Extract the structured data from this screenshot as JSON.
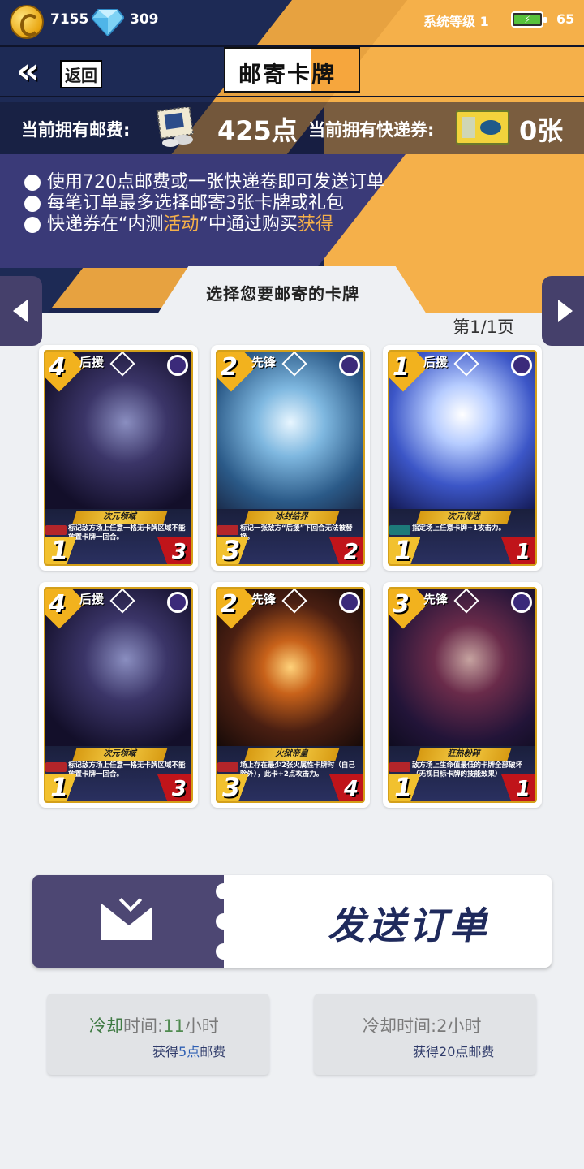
{
  "status": {
    "coins": "7155",
    "gems": "309",
    "system_level": "系统等级 1",
    "battery": "65"
  },
  "header": {
    "back_label": "返回",
    "title": "邮寄卡牌"
  },
  "currency": {
    "postage_label": "当前拥有邮费:",
    "postage_value": "425点",
    "ticket_label": "当前拥有快递券:",
    "ticket_value": "0张"
  },
  "rules": [
    {
      "text": "使用720点邮费或一张快递卷即可发送订单"
    },
    {
      "text": "每笔订单最多选择邮寄3张卡牌或礼包"
    },
    {
      "text_a": "快递券在“内测",
      "text_b": "活动",
      "text_c": "”中通过购买",
      "text_d": "获得"
    }
  ],
  "select_title": "选择您要邮寄的卡牌",
  "page_info": "第1/1页",
  "cards": [
    {
      "cost": "4",
      "role": "后援",
      "name": "次元领域",
      "desc": "标记敌方场上任意一格无卡牌区域不能放置卡牌一回合。",
      "atk": "1",
      "hp": "3",
      "art": "void"
    },
    {
      "cost": "2",
      "role": "先锋",
      "name": "冰封结界",
      "desc": "标记一张敌方“后援”下回合无法被替换。",
      "atk": "3",
      "hp": "2",
      "art": "ice"
    },
    {
      "cost": "1",
      "role": "后援",
      "name": "次元传送",
      "desc": "指定场上任意卡牌+1攻击力。",
      "atk": "1",
      "hp": "1",
      "art": "mech"
    },
    {
      "cost": "4",
      "role": "后援",
      "name": "次元领域",
      "desc": "标记敌方场上任意一格无卡牌区域不能放置卡牌一回合。",
      "atk": "1",
      "hp": "3",
      "art": "void"
    },
    {
      "cost": "2",
      "role": "先锋",
      "name": "火狱帝皇",
      "desc": "场上存在最少2张火属性卡牌时（自己除外），此卡+2点攻击力。",
      "atk": "3",
      "hp": "4",
      "art": "fire"
    },
    {
      "cost": "3",
      "role": "先锋",
      "name": "狂热粉碎",
      "desc": "敌方场上生命值最低的卡牌全部破坏（无视目标卡牌的技能效果）",
      "atk": "1",
      "hp": "1",
      "art": "red"
    }
  ],
  "send_order_label": "发送订单",
  "cooldowns": [
    {
      "label_a": "冷却",
      "label_b": "时间:",
      "num": "11",
      "unit": "小时",
      "gain_a": "获得",
      "gain_num": "5点",
      "gain_b": "邮费"
    },
    {
      "label_a": "冷却",
      "label_b": "时间:",
      "num": "2",
      "unit": "小时",
      "gain_a": "获得",
      "gain_num": "20点",
      "gain_b": "邮费"
    }
  ],
  "colors": {
    "navy": "#1d2a55",
    "orange": "#f5b04a",
    "purple_button": "#4d4773",
    "send_text": "#1f2a5c"
  },
  "icons": [
    "coin-icon",
    "gem-icon",
    "battery-icon",
    "back-chevron-icon",
    "stamp-icon",
    "ticket-icon",
    "envelope-icon",
    "arrow-left-icon",
    "arrow-right-icon"
  ]
}
